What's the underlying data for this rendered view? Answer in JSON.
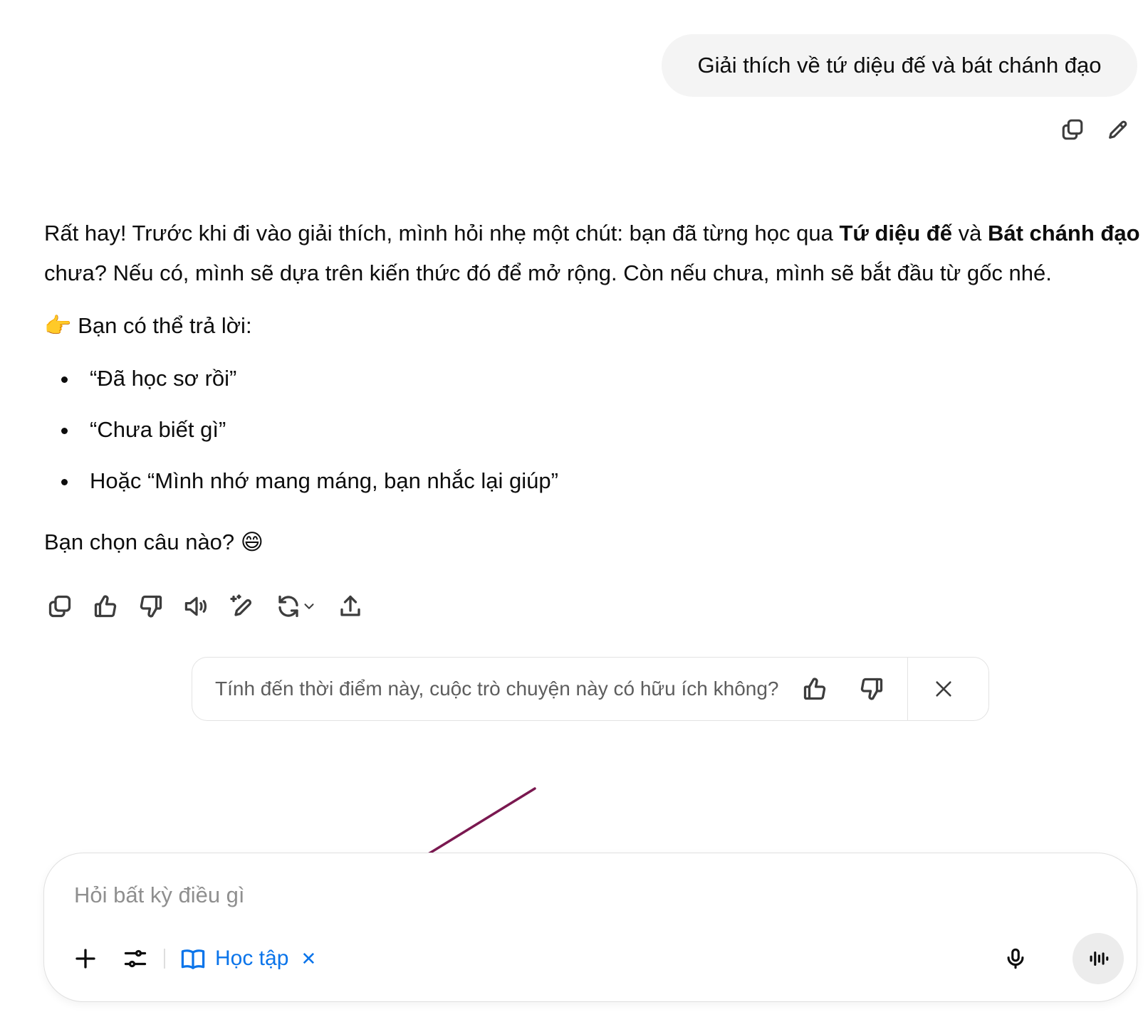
{
  "user_message": {
    "text": "Giải thích về tứ diệu đế và bát chánh đạo"
  },
  "assistant": {
    "intro_part1": "Rất hay! Trước khi đi vào giải thích, mình hỏi nhẹ một chút: bạn đã từng học qua ",
    "intro_bold1": "Tứ diệu đế",
    "intro_part2": " và ",
    "intro_bold2": "Bát chánh đạo",
    "intro_part3": " chưa? Nếu có, mình sẽ dựa trên kiến thức đó để mở rộng. Còn nếu chưa, mình sẽ bắt đầu từ gốc nhé.",
    "prompt_emoji": "👉",
    "prompt_text": " Bạn có thể trả lời:",
    "options": [
      "“Đã học sơ rồi”",
      "“Chưa biết gì”",
      "Hoặc “Mình nhớ mang máng, bạn nhắc lại giúp”"
    ],
    "closing_text": "Bạn chọn câu nào? ",
    "closing_emoji": "😄"
  },
  "feedback": {
    "question": "Tính đến thời điểm này, cuộc trò chuyện này có hữu ích không?"
  },
  "composer": {
    "placeholder": "Hỏi bất kỳ điều gì",
    "chip_label": "Học tập",
    "chip_close": "✕"
  },
  "colors": {
    "accent": "#0a74ea",
    "annotation_arrow": "#7a1850"
  },
  "icons": {
    "user_actions": [
      "copy-icon",
      "edit-icon"
    ],
    "assistant_actions": [
      "copy-icon",
      "thumbs-up-icon",
      "thumbs-down-icon",
      "read-aloud-icon",
      "edit-canvas-icon",
      "regenerate-icon",
      "share-icon"
    ]
  }
}
